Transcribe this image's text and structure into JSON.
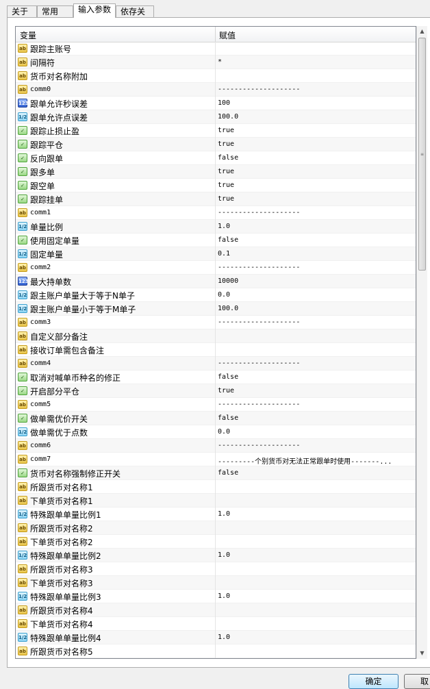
{
  "tabs": [
    "关于",
    "常用",
    "输入参数",
    "依存关系"
  ],
  "active_tab": 2,
  "table": {
    "header": {
      "variable": "变量",
      "value": "赋值"
    },
    "rows": [
      {
        "icon": "string",
        "name": "跟踪主账号",
        "value": ""
      },
      {
        "icon": "string",
        "name": "间隔符",
        "value": "*"
      },
      {
        "icon": "string",
        "name": "货币对名称附加",
        "value": ""
      },
      {
        "icon": "string",
        "name": "comm0",
        "value": "--------------------"
      },
      {
        "icon": "int",
        "name": "跟单允许秒误差",
        "value": "100"
      },
      {
        "icon": "double",
        "name": "跟单允许点误差",
        "value": "100.0"
      },
      {
        "icon": "bool",
        "name": "跟踪止损止盈",
        "value": "true"
      },
      {
        "icon": "bool",
        "name": "跟踪平仓",
        "value": "true"
      },
      {
        "icon": "bool",
        "name": "反向跟单",
        "value": "false"
      },
      {
        "icon": "bool",
        "name": "跟多单",
        "value": "true"
      },
      {
        "icon": "bool",
        "name": "跟空单",
        "value": "true"
      },
      {
        "icon": "bool",
        "name": "跟踪挂单",
        "value": "true"
      },
      {
        "icon": "string",
        "name": "comm1",
        "value": "--------------------"
      },
      {
        "icon": "double",
        "name": "单量比例",
        "value": "1.0"
      },
      {
        "icon": "bool",
        "name": "使用固定单量",
        "value": "false"
      },
      {
        "icon": "double",
        "name": "固定单量",
        "value": "0.1"
      },
      {
        "icon": "string",
        "name": "comm2",
        "value": "--------------------"
      },
      {
        "icon": "int",
        "name": "最大持单数",
        "value": "10000"
      },
      {
        "icon": "double",
        "name": "跟主账户单量大于等于N单子",
        "value": "0.0"
      },
      {
        "icon": "double",
        "name": "跟主账户单量小于等于M单子",
        "value": "100.0"
      },
      {
        "icon": "string",
        "name": "comm3",
        "value": "--------------------"
      },
      {
        "icon": "string",
        "name": "自定义部分备注",
        "value": ""
      },
      {
        "icon": "string",
        "name": "接收订单需包含备注",
        "value": ""
      },
      {
        "icon": "string",
        "name": "comm4",
        "value": "--------------------"
      },
      {
        "icon": "bool",
        "name": "取消对喊单币种名的修正",
        "value": "false"
      },
      {
        "icon": "bool",
        "name": "开启部分平仓",
        "value": "true"
      },
      {
        "icon": "string",
        "name": "comm5",
        "value": "--------------------"
      },
      {
        "icon": "bool",
        "name": "做单需优价开关",
        "value": "false"
      },
      {
        "icon": "double",
        "name": "做单需优于点数",
        "value": "0.0"
      },
      {
        "icon": "string",
        "name": "comm6",
        "value": "--------------------"
      },
      {
        "icon": "string",
        "name": "comm7",
        "value": "---------个别货币对无法正常跟单时使用-------..."
      },
      {
        "icon": "bool",
        "name": "货币对名称强制修正开关",
        "value": "false"
      },
      {
        "icon": "string",
        "name": "所跟货币对名称1",
        "value": ""
      },
      {
        "icon": "string",
        "name": "下单货币对名称1",
        "value": ""
      },
      {
        "icon": "double",
        "name": "特殊跟单单量比例1",
        "value": "1.0"
      },
      {
        "icon": "string",
        "name": "所跟货币对名称2",
        "value": ""
      },
      {
        "icon": "string",
        "name": "下单货币对名称2",
        "value": ""
      },
      {
        "icon": "double",
        "name": "特殊跟单单量比例2",
        "value": "1.0"
      },
      {
        "icon": "string",
        "name": "所跟货币对名称3",
        "value": ""
      },
      {
        "icon": "string",
        "name": "下单货币对名称3",
        "value": ""
      },
      {
        "icon": "double",
        "name": "特殊跟单单量比例3",
        "value": "1.0"
      },
      {
        "icon": "string",
        "name": "所跟货币对名称4",
        "value": ""
      },
      {
        "icon": "string",
        "name": "下单货币对名称4",
        "value": ""
      },
      {
        "icon": "double",
        "name": "特殊跟单单量比例4",
        "value": "1.0"
      },
      {
        "icon": "string",
        "name": "所跟货币对名称5",
        "value": ""
      }
    ]
  },
  "icon_labels": {
    "string": "ab",
    "int": "123",
    "double": "1/2",
    "bool": "✓"
  },
  "buttons": {
    "ok": "确定",
    "reset": "取"
  }
}
